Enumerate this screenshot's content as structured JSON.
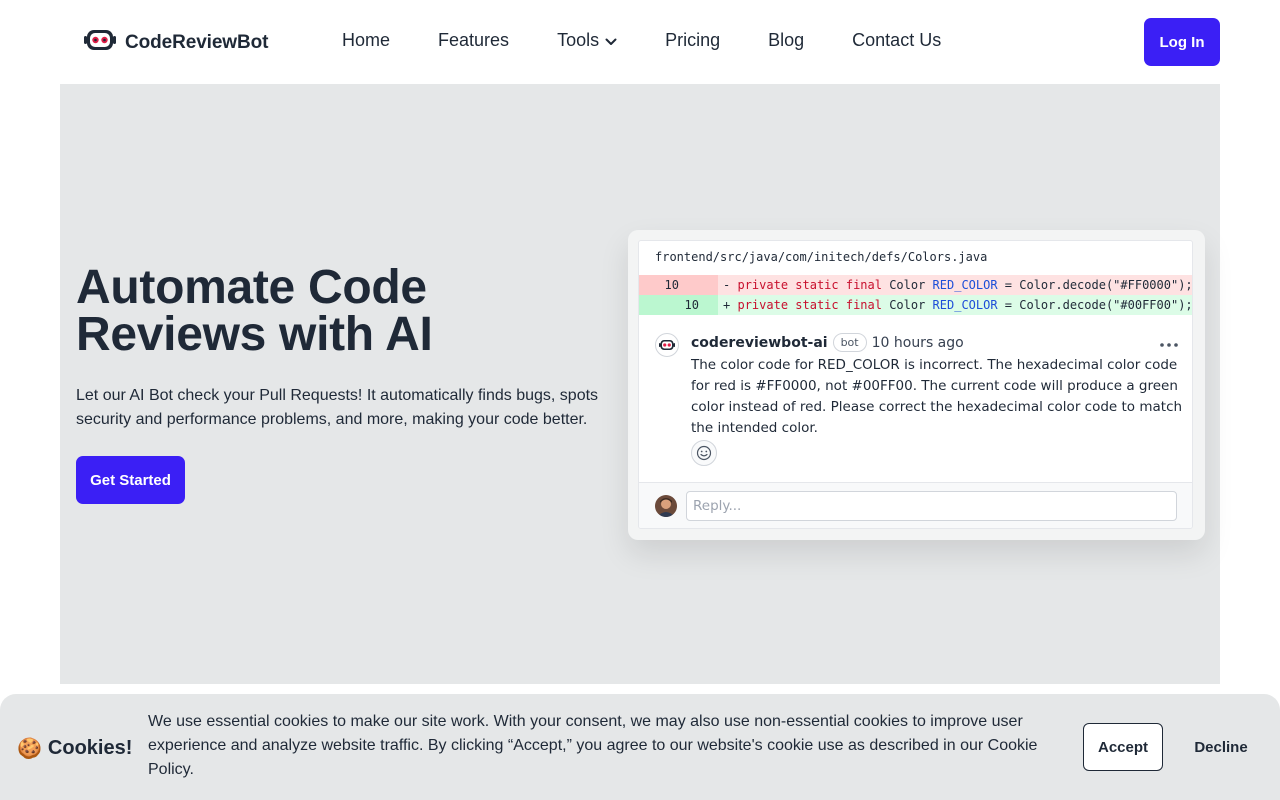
{
  "header": {
    "brand": "CodeReviewBot",
    "nav": [
      {
        "label": "Home"
      },
      {
        "label": "Features"
      },
      {
        "label": "Tools",
        "has_dropdown": true
      },
      {
        "label": "Pricing"
      },
      {
        "label": "Blog"
      },
      {
        "label": "Contact Us"
      }
    ],
    "login_label": "Log In"
  },
  "hero": {
    "title": "Automate Code Reviews with AI",
    "subtitle": "Let our AI Bot check your Pull Requests! It automatically finds bugs, spots security and performance problems, and more, making your code better.",
    "cta_label": "Get Started"
  },
  "review": {
    "file_path": "frontend/src/java/com/initech/defs/Colors.java",
    "diff": [
      {
        "type": "del",
        "old_line": "10",
        "new_line": "",
        "sign": "-",
        "keywords": "private static final",
        "type_name": " Color ",
        "var": "RED_COLOR",
        "rest": " = Color.decode(\"#FF0000\");"
      },
      {
        "type": "add",
        "old_line": "",
        "new_line": "10",
        "sign": "+",
        "keywords": "private static final",
        "type_name": " Color ",
        "var": "RED_COLOR",
        "rest": " = Color.decode(\"#00FF00\");"
      }
    ],
    "comment": {
      "user": "codereviewbot-ai",
      "badge": "bot",
      "time": "10 hours ago",
      "body": "The color code for RED_COLOR is incorrect. The hexadecimal color code for red is #FF0000, not #00FF00. The current code will produce a green color instead of red. Please correct the hexadecimal color code to match the intended color."
    },
    "reply_placeholder": "Reply..."
  },
  "cookie": {
    "emoji": "🍪",
    "title": "Cookies!",
    "text": "We use essential cookies to make our site work. With your consent, we may also use non-essential cookies to improve user experience and analyze website traffic. By clicking “Accept,” you agree to our website's cookie use as described in our Cookie Policy.",
    "accept_label": "Accept",
    "decline_label": "Decline"
  },
  "colors": {
    "accent": "#3b1ff5",
    "hero_bg": "#e5e7e8",
    "diff_del_bg": "#fee2e2",
    "diff_add_bg": "#dcfce7",
    "keyword": "#c8102e",
    "identifier": "#1d4ed8"
  },
  "icons": {
    "logo": "robot-face-icon",
    "tools_dropdown": "chevron-down-icon",
    "more": "ellipsis-icon",
    "reaction": "smiley-icon",
    "bot_avatar": "robot-avatar-icon",
    "user_avatar": "user-avatar"
  }
}
